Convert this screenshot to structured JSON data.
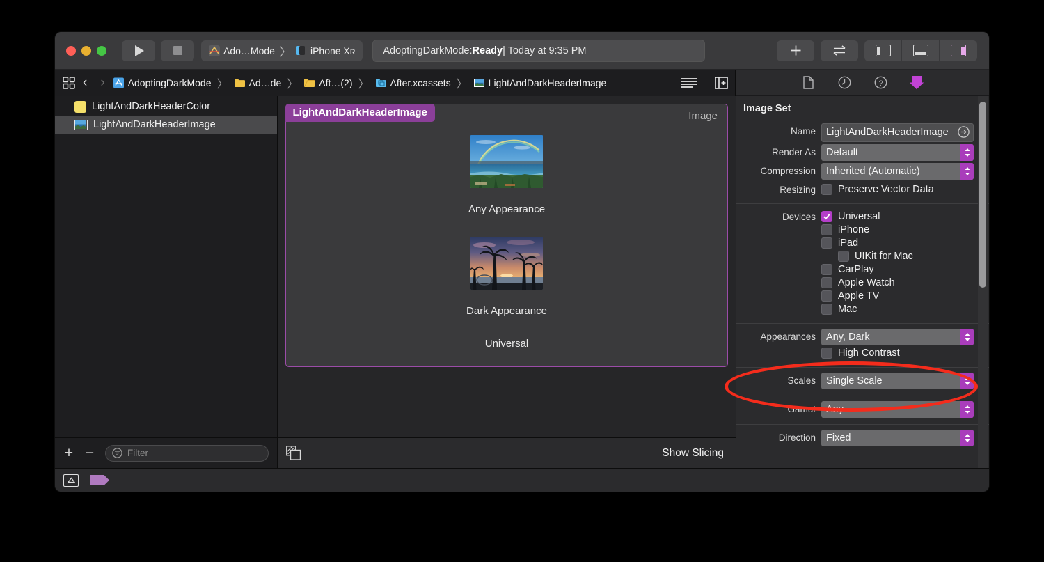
{
  "window": {
    "traffic_lights": [
      "close",
      "minimize",
      "zoom"
    ],
    "run_button": "run",
    "stop_button": "stop",
    "scheme": {
      "project": "Ado…Mode",
      "separator": "〉",
      "destination": "iPhone Xʀ"
    },
    "status": {
      "prefix": "AdoptingDarkMode: ",
      "state": "Ready",
      "suffix": " | Today at 9:35 PM"
    },
    "right_buttons": {
      "add": "+",
      "swap": "⇄"
    },
    "panel_toggles": [
      "left-panel",
      "bottom-panel",
      "right-panel"
    ]
  },
  "breadcrumb": {
    "back": "‹",
    "forward": "›",
    "items": [
      {
        "label": "AdoptingDarkMode",
        "icon": "xcode-project-icon"
      },
      {
        "label": "Ad…de",
        "icon": "folder-icon"
      },
      {
        "label": "Aft…(2)",
        "icon": "folder-icon"
      },
      {
        "label": "After.xcassets",
        "icon": "assets-folder-icon"
      },
      {
        "label": "LightAndDarkHeaderImage",
        "icon": "image-set-icon"
      }
    ],
    "separator": "〉",
    "tools": [
      "list-view-icon",
      "add-editor-icon"
    ]
  },
  "inspector_tabs": [
    {
      "name": "file-inspector",
      "icon": "document-icon",
      "selected": false
    },
    {
      "name": "history-inspector",
      "icon": "clock-icon",
      "selected": false
    },
    {
      "name": "quick-help-inspector",
      "icon": "help-icon",
      "selected": false
    },
    {
      "name": "attributes-inspector",
      "icon": "down-arrow-icon",
      "selected": true
    }
  ],
  "navigator": {
    "items": [
      {
        "label": "LightAndDarkHeaderColor",
        "icon": "color-swatch-icon",
        "selected": false
      },
      {
        "label": "LightAndDarkHeaderImage",
        "icon": "image-thumbnail-icon",
        "selected": true
      }
    ],
    "footer": {
      "add": "+",
      "remove": "−",
      "filter_placeholder": "Filter",
      "filter_value": ""
    }
  },
  "editor": {
    "card_title": "LightAndDarkHeaderImage",
    "card_type": "Image",
    "slots": [
      {
        "label": "Any Appearance",
        "image": "beach-rainbow-photo"
      },
      {
        "label": "Dark Appearance",
        "image": "palm-sunset-photo"
      }
    ],
    "group_label": "Universal",
    "footer": {
      "slicing_icon": "slicing-icon",
      "show_slicing": "Show Slicing"
    }
  },
  "inspector": {
    "title": "Image Set",
    "name": {
      "label": "Name",
      "value": "LightAndDarkHeaderImage"
    },
    "render_as": {
      "label": "Render As",
      "value": "Default"
    },
    "compression": {
      "label": "Compression",
      "value": "Inherited (Automatic)"
    },
    "resizing": {
      "label": "Resizing",
      "checkbox_label": "Preserve Vector Data",
      "checked": false
    },
    "devices": {
      "label": "Devices",
      "items": [
        {
          "label": "Universal",
          "checked": true,
          "indent": false
        },
        {
          "label": "iPhone",
          "checked": false,
          "indent": false
        },
        {
          "label": "iPad",
          "checked": false,
          "indent": false
        },
        {
          "label": "UIKit for Mac",
          "checked": false,
          "indent": true
        },
        {
          "label": "CarPlay",
          "checked": false,
          "indent": false
        },
        {
          "label": "Apple Watch",
          "checked": false,
          "indent": false
        },
        {
          "label": "Apple TV",
          "checked": false,
          "indent": false
        },
        {
          "label": "Mac",
          "checked": false,
          "indent": false
        }
      ]
    },
    "appearances": {
      "label": "Appearances",
      "value": "Any, Dark",
      "high_contrast_label": "High Contrast",
      "high_contrast_checked": false,
      "highlighted": true
    },
    "scales": {
      "label": "Scales",
      "value": "Single Scale"
    },
    "gamut": {
      "label": "Gamut",
      "value": "Any"
    },
    "direction": {
      "label": "Direction",
      "value": "Fixed"
    }
  },
  "bottom_strip": {
    "toggle_icon": "show-debug-area-icon",
    "tag_icon": "purple-tag-icon"
  },
  "colors": {
    "accent_purple": "#a93dbb",
    "card_border": "#9b4ca8",
    "card_title_bg": "#8b3f99",
    "annotation_red": "#f42c1c",
    "window_bg": "#2b2b2d",
    "titlebar_bg": "#3a3a3c",
    "navigator_bg": "#1e1e20",
    "editor_bg": "#262628"
  }
}
